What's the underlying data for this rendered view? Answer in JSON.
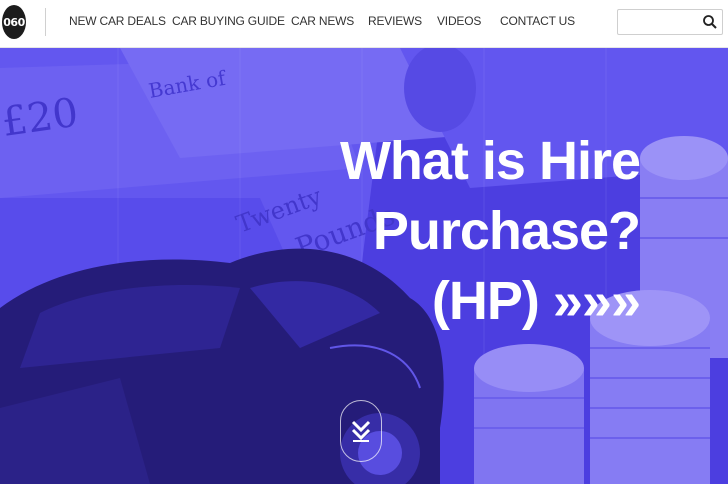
{
  "logo": {
    "text": "060"
  },
  "nav": {
    "items": [
      {
        "label": "NEW CAR DEALS"
      },
      {
        "label": "CAR BUYING GUIDE"
      },
      {
        "label": "CAR NEWS"
      },
      {
        "label": "REVIEWS"
      },
      {
        "label": "VIDEOS"
      },
      {
        "label": "CONTACT US"
      }
    ]
  },
  "search": {
    "placeholder": "",
    "value": "",
    "icon": "search-icon"
  },
  "hero": {
    "line1": "What is Hire",
    "line2": "Purchase?",
    "line3": "(HP) »»»",
    "tint_color": "#4a3fe0",
    "scroll_icon": "chevron-double-down-icon"
  }
}
